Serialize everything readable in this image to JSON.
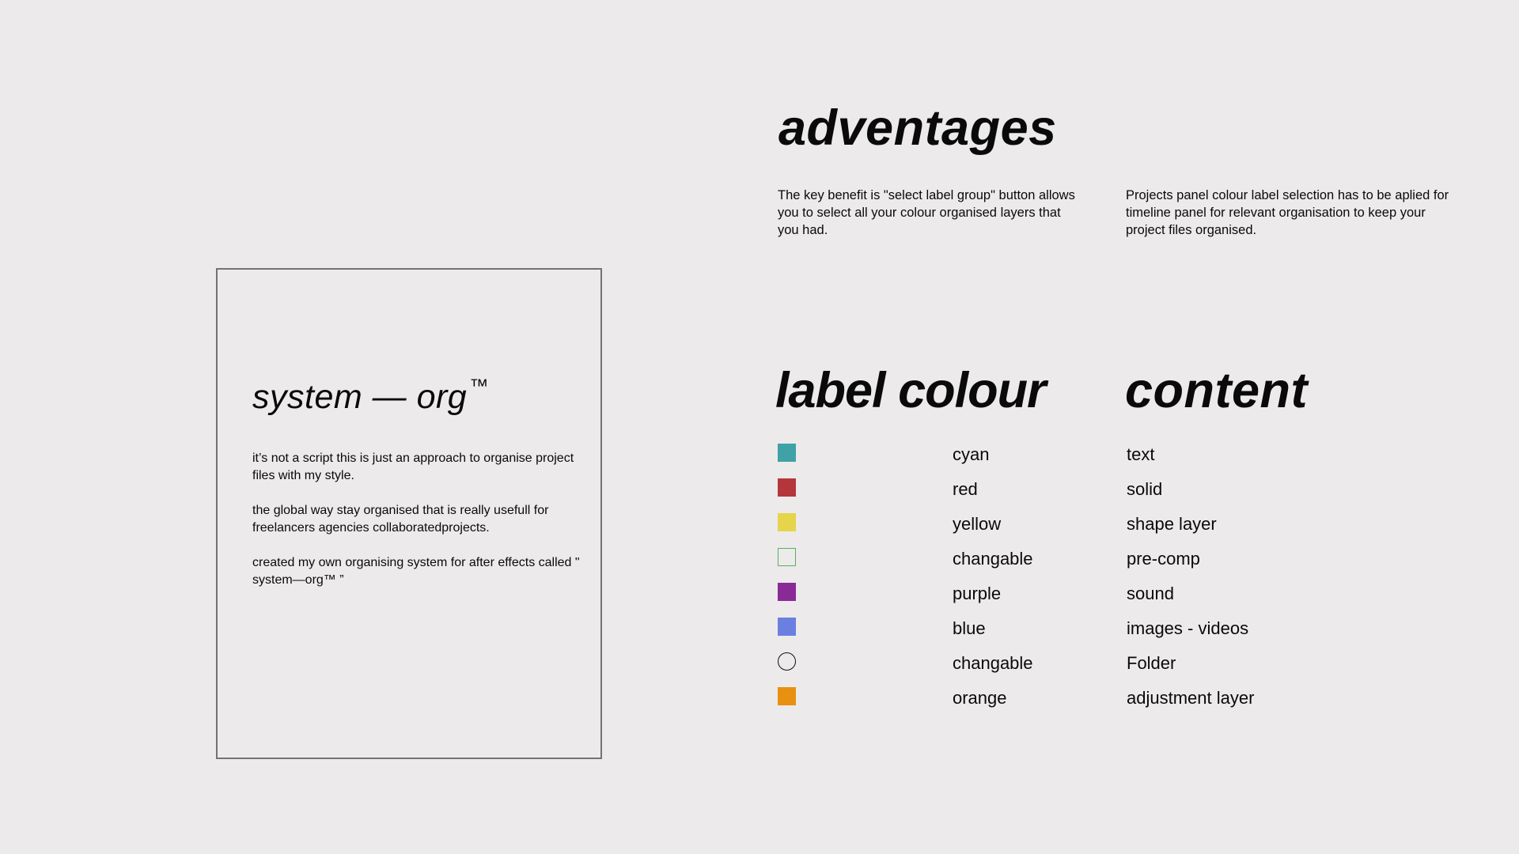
{
  "card": {
    "title": "system — org",
    "trademark": "™",
    "paragraphs": [
      "it’s not a script this is just an approach to organise project files with my style.",
      "the global way stay organised that is really usefull for freelancers agencies collaboratedprojects.",
      "created my own organising system for after effects called \" system—org™ ”"
    ]
  },
  "advantages": {
    "title": "adventages",
    "paragraphs": [
      "The key benefit is \"select label group\" button allows you to select all your colour organised layers that you had.",
      "Projects panel colour label selection has to be aplied for timeline panel for relevant organisation to keep your project files organised."
    ]
  },
  "table": {
    "label_header": "label colour",
    "content_header": "content",
    "rows": [
      {
        "swatch": "square",
        "color": "#3fa2a6",
        "label": "cyan",
        "content": "text"
      },
      {
        "swatch": "square",
        "color": "#b5363a",
        "label": "red",
        "content": "solid"
      },
      {
        "swatch": "square",
        "color": "#e6d44a",
        "label": "yellow",
        "content": "shape layer"
      },
      {
        "swatch": "outline",
        "color": "#5cb05c",
        "label": "changable",
        "content": "pre-comp"
      },
      {
        "swatch": "square",
        "color": "#8a2a96",
        "label": "purple",
        "content": "sound"
      },
      {
        "swatch": "square",
        "color": "#6a7fe0",
        "label": "blue",
        "content": "images - videos"
      },
      {
        "swatch": "circle",
        "color": "#111111",
        "label": "changable",
        "content": "Folder"
      },
      {
        "swatch": "square",
        "color": "#e8900f",
        "label": "orange",
        "content": "adjustment layer"
      }
    ]
  }
}
